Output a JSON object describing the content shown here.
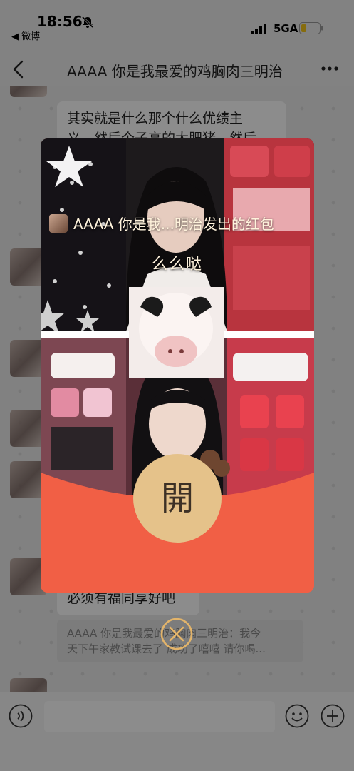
{
  "status_bar": {
    "time": "18:56",
    "back_app": "◀ 微博",
    "network": "5GA"
  },
  "chat_header": {
    "title": "AAAA 你是我最爱的鸡胸肉三明治"
  },
  "messages": {
    "bubble_partial_line1": "其实就是什么那个什么优绩主",
    "bubble_partial_line2": "义，然后个子高的大肥猪，然后",
    "bubble_bottom": "必须有福同享好吧",
    "quote_line1": "AAAA 你是我最爱的鸡胸肉三明治：我今",
    "quote_line2": "天下午家教试课去了 成功了嘻嘻 请你喝..."
  },
  "red_packet": {
    "sender_text": "AAAA 你是我...明治发出的红包",
    "blessing": "么么哒",
    "open_label": "開"
  },
  "colors": {
    "packet_red": "#f15f45",
    "open_gold": "#e5c28a",
    "close_gold": "#e3b46a"
  },
  "icons": [
    "bell-slash-icon",
    "signal-icon",
    "battery-icon",
    "back-icon",
    "more-icon",
    "voice-icon",
    "emoji-icon",
    "plus-icon",
    "close-icon"
  ]
}
